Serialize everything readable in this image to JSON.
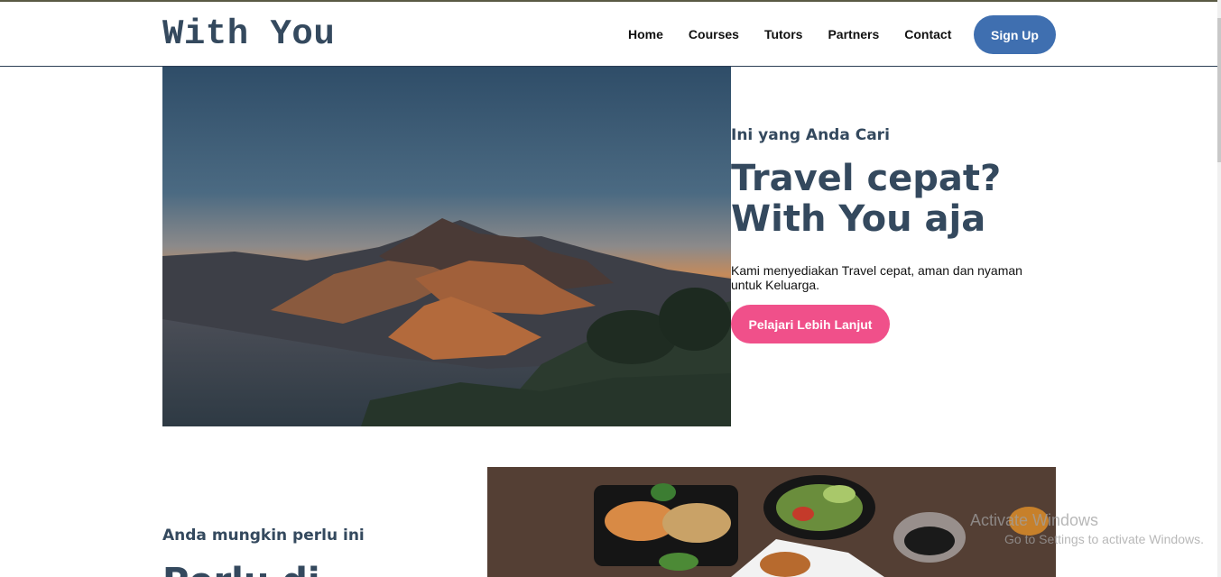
{
  "brand": "With You",
  "nav": {
    "items": [
      "Home",
      "Courses",
      "Tutors",
      "Partners",
      "Contact"
    ],
    "signup_label": "Sign Up"
  },
  "hero": {
    "eyebrow": "Ini yang Anda Cari",
    "title_line1": "Travel cepat?",
    "title_line2": "With You aja",
    "description": "Kami menyediakan Travel cepat, aman dan nyaman untuk Keluarga.",
    "cta_label": "Pelajari Lebih Lanjut"
  },
  "section2": {
    "eyebrow": "Anda mungkin perlu ini",
    "title": "Perlu di"
  },
  "watermark": {
    "title": "Activate Windows",
    "subtitle": "Go to Settings to activate Windows."
  },
  "colors": {
    "heading": "#34495e",
    "signup": "#3f6fb0",
    "cta": "#f0508a"
  }
}
